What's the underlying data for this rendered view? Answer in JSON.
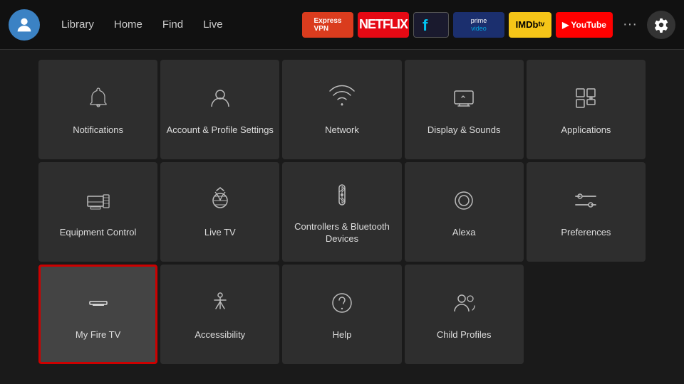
{
  "nav": {
    "links": [
      "Library",
      "Home",
      "Find",
      "Live"
    ],
    "apps": [
      {
        "name": "expressvpn",
        "label": "ExpressVPN"
      },
      {
        "name": "netflix",
        "label": "NETFLIX"
      },
      {
        "name": "freevee",
        "label": "f"
      },
      {
        "name": "prime",
        "label": "prime video"
      },
      {
        "name": "imdb",
        "label": "IMDb tv"
      },
      {
        "name": "youtube",
        "label": "▶ YouTube"
      }
    ],
    "more": "···",
    "settings_label": "settings"
  },
  "grid": {
    "items": [
      {
        "id": "notifications",
        "label": "Notifications"
      },
      {
        "id": "account-profile",
        "label": "Account & Profile Settings"
      },
      {
        "id": "network",
        "label": "Network"
      },
      {
        "id": "display-sounds",
        "label": "Display & Sounds"
      },
      {
        "id": "applications",
        "label": "Applications"
      },
      {
        "id": "equipment-control",
        "label": "Equipment Control"
      },
      {
        "id": "live-tv",
        "label": "Live TV"
      },
      {
        "id": "controllers-bluetooth",
        "label": "Controllers & Bluetooth Devices"
      },
      {
        "id": "alexa",
        "label": "Alexa"
      },
      {
        "id": "preferences",
        "label": "Preferences"
      },
      {
        "id": "my-fire-tv",
        "label": "My Fire TV",
        "selected": true
      },
      {
        "id": "accessibility",
        "label": "Accessibility"
      },
      {
        "id": "help",
        "label": "Help"
      },
      {
        "id": "child-profiles",
        "label": "Child Profiles"
      }
    ]
  }
}
